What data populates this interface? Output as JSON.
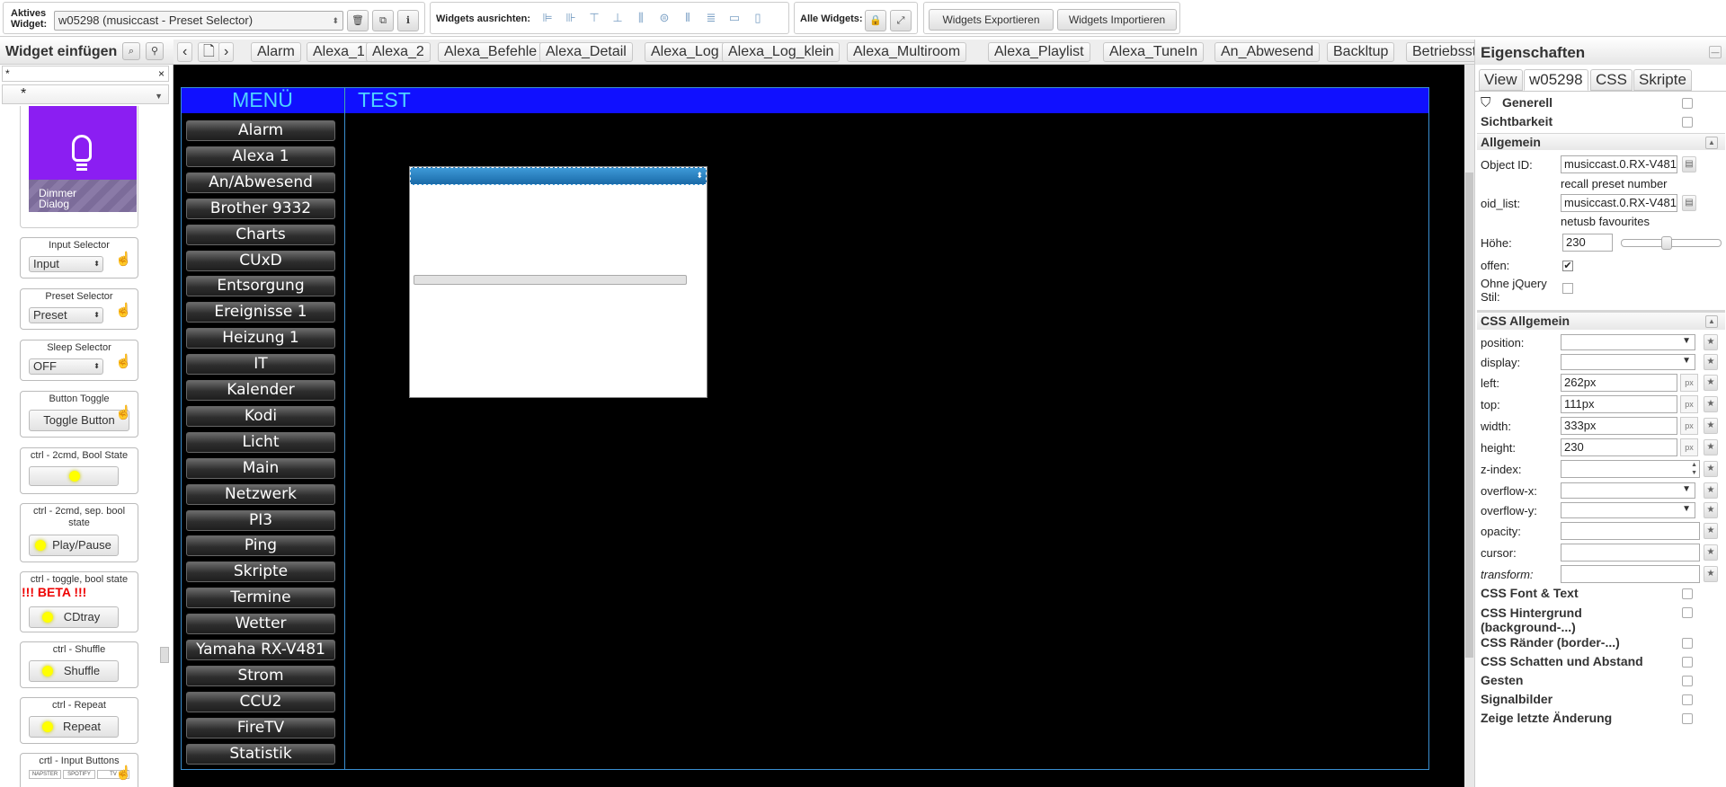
{
  "toolbar": {
    "active_widget_label_1": "Aktives",
    "active_widget_label_2": "Widget:",
    "active_widget_value": "w05298 (musiccast - Preset Selector)",
    "align_label": "Widgets ausrichten:",
    "all_widgets_label": "Alle Widgets:",
    "export_label": "Widgets Exportieren",
    "import_label": "Widgets Importieren"
  },
  "widget_panel": {
    "title": "Widget einfügen",
    "filter_value": "*",
    "filter_clear": "×",
    "set_value": "*",
    "dimmer_label_1": "Dimmer",
    "dimmer_label_2": "Dialog",
    "cards": [
      {
        "title": "Input Selector",
        "preview": "Input"
      },
      {
        "title": "Preset Selector",
        "preview": "Preset"
      },
      {
        "title": "Sleep Selector",
        "preview": "OFF"
      },
      {
        "title": "Button Toggle",
        "preview": "Toggle Button"
      },
      {
        "title": "ctrl - 2cmd, Bool State",
        "preview": ""
      },
      {
        "title": "ctrl - 2cmd, sep. bool state",
        "preview": "Play/Pause"
      },
      {
        "title": "ctrl - toggle, bool state",
        "beta": "!!! BETA !!!",
        "preview": "CDtray"
      },
      {
        "title": "ctrl - Shuffle",
        "preview": "Shuffle"
      },
      {
        "title": "ctrl - Repeat",
        "preview": "Repeat"
      },
      {
        "title": "crtl - Input Buttons",
        "mini": [
          "NAPSTER",
          "SPOTIFY",
          "TV"
        ]
      }
    ]
  },
  "view_tabs": [
    "Alarm",
    "Alexa_1",
    "Alexa_2",
    "Alexa_Befehle",
    "Alexa_Detail",
    "Alexa_Log",
    "Alexa_Log_klein",
    "Alexa_Multiroom",
    "Alexa_Playlist",
    "Alexa_TuneIn",
    "An_Abwesend",
    "Backltup",
    "Betriebsstunde"
  ],
  "canvas": {
    "menu_title": "MENÜ",
    "view_title": "TEST",
    "menu_items": [
      "Alarm",
      "Alexa 1",
      "An/Abwesend",
      "Brother 9332",
      "Charts",
      "CUxD",
      "Entsorgung",
      "Ereignisse 1",
      "Heizung 1",
      "IT",
      "Kalender",
      "Kodi",
      "Licht",
      "Main",
      "Netzwerk",
      "PI3",
      "Ping",
      "Skripte",
      "Termine",
      "Wetter",
      "Yamaha RX-V481",
      "Strom",
      "CCU2",
      "FireTV",
      "Statistik"
    ]
  },
  "properties": {
    "title": "Eigenschaften",
    "tabs": [
      "View",
      "w05298",
      "CSS",
      "Skripte"
    ],
    "sections": {
      "generell": "Generell",
      "sichtbarkeit": "Sichtbarkeit",
      "allgemein": "Allgemein",
      "css_allgemein": "CSS Allgemein",
      "css_font": "CSS Font & Text",
      "css_bg_1": "CSS Hintergrund",
      "css_bg_2": "(background-...)",
      "css_border": "CSS Ränder (border-...)",
      "css_shadow": "CSS Schatten und Abstand",
      "gesten": "Gesten",
      "signalbilder": "Signalbilder",
      "letzte": "Zeige letzte Änderung"
    },
    "object_id_label": "Object ID:",
    "object_id_value": "musiccast.0.RX-V481",
    "object_id_hint": "recall preset number",
    "oid_list_label": "oid_list:",
    "oid_list_value": "musiccast.0.RX-V481",
    "oid_list_hint": "netusb favourites",
    "hoehe_label": "Höhe:",
    "hoehe_value": "230",
    "offen_label": "offen:",
    "ohne_label_1": "Ohne jQuery",
    "ohne_label_2": "Stil:",
    "css": {
      "position_label": "position:",
      "display_label": "display:",
      "left_label": "left:",
      "left_value": "262px",
      "top_label": "top:",
      "top_value": "111px",
      "width_label": "width:",
      "width_value": "333px",
      "height_label": "height:",
      "height_value": "230",
      "zindex_label": "z-index:",
      "overflowx_label": "overflow-x:",
      "overflowy_label": "overflow-y:",
      "opacity_label": "opacity:",
      "cursor_label": "cursor:",
      "transform_label": "transform:",
      "px_unit": "px"
    }
  }
}
